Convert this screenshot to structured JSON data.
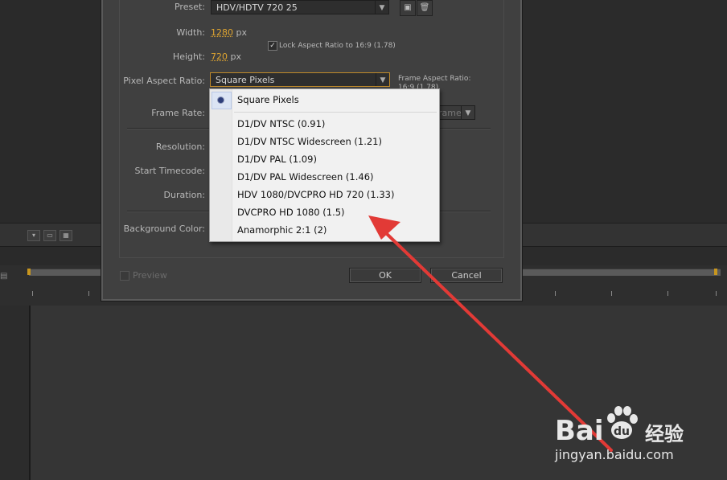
{
  "dialog": {
    "preset_label": "Preset:",
    "preset_value": "HDV/HDTV 720 25",
    "width_label": "Width:",
    "width_value": "1280",
    "width_unit": "px",
    "height_label": "Height:",
    "height_value": "720",
    "height_unit": "px",
    "lock_aspect_label": "Lock Aspect Ratio to 16:9 (1.78)",
    "lock_aspect_checked": true,
    "pixel_aspect_label": "Pixel Aspect Ratio:",
    "pixel_aspect_value": "Square Pixels",
    "frame_aspect_label": "Frame Aspect Ratio:",
    "frame_aspect_partial": "16:9 (1.78)",
    "frame_rate_label": "Frame Rate:",
    "frame_rate_hidden_partial": "rame",
    "resolution_label": "Resolution:",
    "start_timecode_label": "Start Timecode:",
    "duration_label": "Duration:",
    "background_color_label": "Background Color:",
    "preview_label": "Preview",
    "ok_label": "OK",
    "cancel_label": "Cancel"
  },
  "menu": {
    "selected": "Square Pixels",
    "items": [
      "Square Pixels",
      "D1/DV NTSC (0.91)",
      "D1/DV NTSC Widescreen (1.21)",
      "D1/DV PAL (1.09)",
      "D1/DV PAL Widescreen (1.46)",
      "HDV 1080/DVCPRO HD 720 (1.33)",
      "DVCPRO HD 1080 (1.5)",
      "Anamorphic 2:1 (2)"
    ]
  },
  "watermark": {
    "brand_left": "Bai",
    "brand_right": "经验",
    "url": "jingyan.baidu.com"
  },
  "colors": {
    "accent_orange": "#e0a530",
    "annotation_red": "#e23a36",
    "radio_blue": "#2d3e7a"
  }
}
